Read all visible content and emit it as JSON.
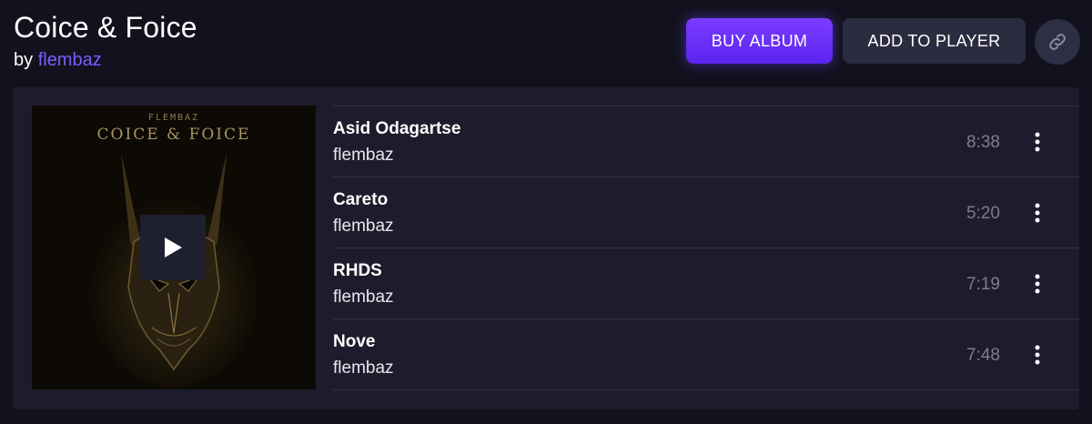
{
  "album": {
    "title": "Coice & Foice",
    "by_prefix": "by",
    "artist": "flembaz"
  },
  "actions": {
    "buy_label": "BUY ALBUM",
    "add_label": "ADD TO PLAYER",
    "link_icon": "link-icon"
  },
  "cover": {
    "artist_text": "FLEMBAZ",
    "title_text": "COICE & FOICE",
    "play_icon": "play-icon"
  },
  "tracks": [
    {
      "title": "Asid Odagartse",
      "artist": "flembaz",
      "duration": "8:38"
    },
    {
      "title": "Careto",
      "artist": "flembaz",
      "duration": "5:20"
    },
    {
      "title": "RHDS",
      "artist": "flembaz",
      "duration": "7:19"
    },
    {
      "title": "Nove",
      "artist": "flembaz",
      "duration": "7:48"
    }
  ],
  "colors": {
    "background": "#12121e",
    "panel": "#1c1c2c",
    "accent": "#6a33ff",
    "artist_link": "#7c5cff",
    "muted": "#7d7d90"
  }
}
